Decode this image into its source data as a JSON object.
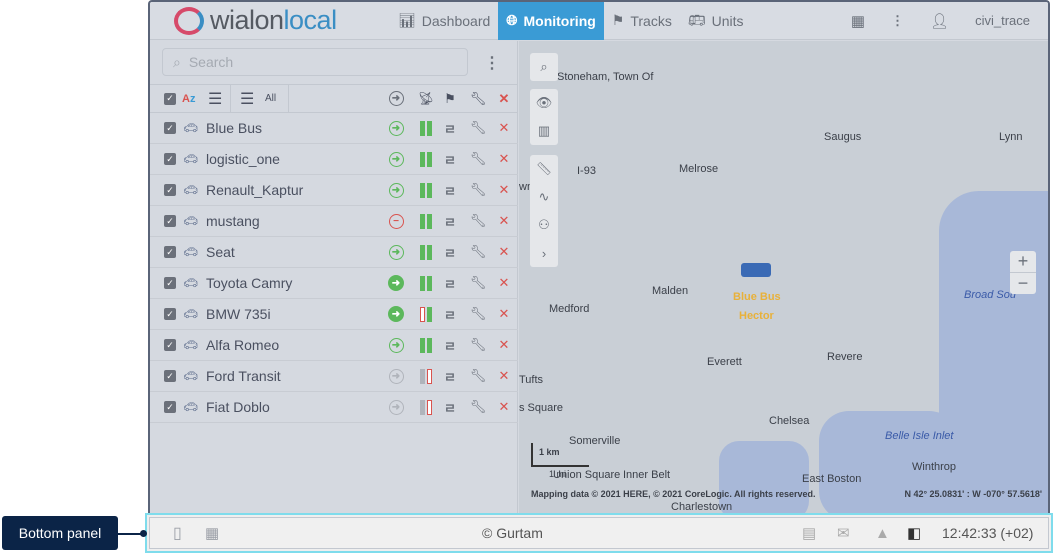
{
  "header": {
    "logo": "wialonlocal",
    "logo_parts": [
      "wialon",
      "local"
    ],
    "nav": [
      {
        "label": "Dashboard",
        "icon": "bar-chart-icon",
        "active": false
      },
      {
        "label": "Monitoring",
        "icon": "globe-icon",
        "active": true
      },
      {
        "label": "Tracks",
        "icon": "checkered-flag-icon",
        "active": false
      },
      {
        "label": "Units",
        "icon": "bus-icon",
        "active": false
      }
    ],
    "username": "civi_trace"
  },
  "search": {
    "placeholder": "Search",
    "value": ""
  },
  "units": [
    {
      "name": "Blue Bus",
      "status": "moving",
      "ignition": [
        "g",
        "g"
      ]
    },
    {
      "name": "logistic_one",
      "status": "moving",
      "ignition": [
        "g",
        "g"
      ]
    },
    {
      "name": "Renault_Kaptur",
      "status": "moving",
      "ignition": [
        "g",
        "g"
      ]
    },
    {
      "name": "mustang",
      "status": "stopped",
      "ignition": [
        "g",
        "g"
      ]
    },
    {
      "name": "Seat",
      "status": "moving",
      "ignition": [
        "g",
        "g"
      ]
    },
    {
      "name": "Toyota Camry",
      "status": "moving-ignition",
      "ignition": [
        "g",
        "g"
      ]
    },
    {
      "name": "BMW 735i",
      "status": "moving-ignition",
      "ignition": [
        "r",
        "g"
      ]
    },
    {
      "name": "Alfa Romeo",
      "status": "moving",
      "ignition": [
        "g",
        "g"
      ]
    },
    {
      "name": "Ford Transit",
      "status": "no-data",
      "ignition": [
        "gr",
        "r"
      ]
    },
    {
      "name": "Fiat Doblo",
      "status": "no-data",
      "ignition": [
        "gr",
        "r"
      ]
    }
  ],
  "map": {
    "labels": [
      "Stoneham, Town Of",
      "Saugus",
      "Lynn",
      "Melrose",
      "Malden",
      "Medford",
      "Everett",
      "Revere",
      "Broad Sou",
      "Tufts",
      "s Square",
      "Chelsea",
      "Belle Isle Inlet",
      "Somerville",
      "Union Square",
      "Inner Belt",
      "East Boston",
      "Winthrop",
      "Charlestown",
      "I-93",
      "wn"
    ],
    "unit_labels": [
      "Blue Bus",
      "Hector"
    ],
    "scale": "1 km",
    "scale2": "1 mi",
    "attribution": "Mapping data © 2021 HERE, © 2021 CoreLogic. All rights reserved.",
    "coords": "N 42° 25.0831' : W -070° 57.5618'",
    "accent_label_color": "#e8b13a"
  },
  "bottom_panel": {
    "copyright": "© Gurtam",
    "time": "12:42:33 (+02)"
  },
  "callout": {
    "label": "Bottom panel"
  },
  "colors": {
    "accent": "#3a9bd5",
    "highlight": "#7fdcec",
    "callout": "#0b2447",
    "ok": "#5cb85c",
    "error": "#d9534f"
  }
}
